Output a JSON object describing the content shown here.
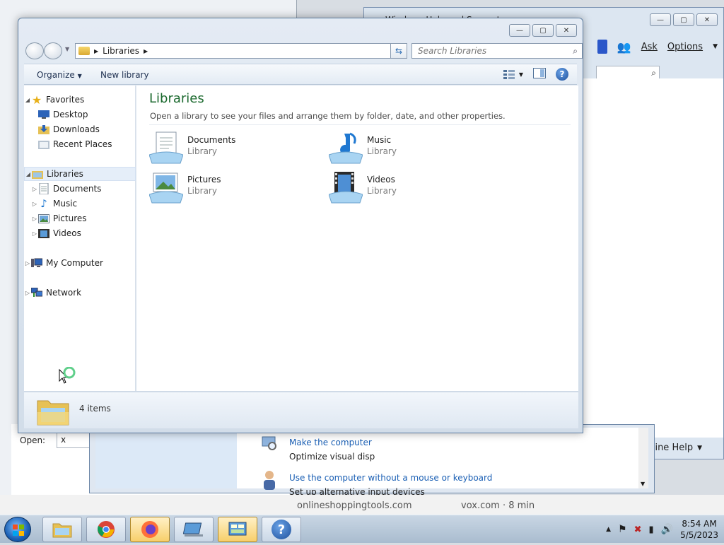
{
  "background": {
    "run_dialog": {
      "open_label": "Open:",
      "open_value": "x"
    },
    "control_panel": {
      "tasks": [
        {
          "link": "Make the computer",
          "desc": "Optimize visual disp"
        },
        {
          "link": "Use the computer without a mouse or keyboard",
          "desc": "Set up alternative input devices"
        }
      ]
    },
    "help_window": {
      "title": "Windows Help and Support",
      "ask_label": "Ask",
      "options_label": "Options",
      "online_help_label": "Online Help"
    },
    "browser_strip": {
      "left_text": "onlineshoppingtools.com",
      "right_text": "vox.com · 8 min"
    }
  },
  "explorer": {
    "breadcrumb": "Libraries",
    "search_placeholder": "Search Libraries",
    "commands": {
      "organize": "Organize",
      "new_library": "New library"
    },
    "nav": {
      "favorites": {
        "label": "Favorites",
        "items": [
          "Desktop",
          "Downloads",
          "Recent Places"
        ]
      },
      "libraries": {
        "label": "Libraries",
        "items": [
          "Documents",
          "Music",
          "Pictures",
          "Videos"
        ]
      },
      "computer": "My Computer",
      "network": "Network"
    },
    "content": {
      "title": "Libraries",
      "subtitle": "Open a library to see your files and arrange them by folder, date, and other properties.",
      "items": [
        {
          "name": "Documents",
          "kind": "Library"
        },
        {
          "name": "Music",
          "kind": "Library"
        },
        {
          "name": "Pictures",
          "kind": "Library"
        },
        {
          "name": "Videos",
          "kind": "Library"
        }
      ]
    },
    "status": {
      "count": "4 items"
    }
  },
  "taskbar": {
    "clock": {
      "time": "8:54 AM",
      "date": "5/5/2023"
    }
  }
}
